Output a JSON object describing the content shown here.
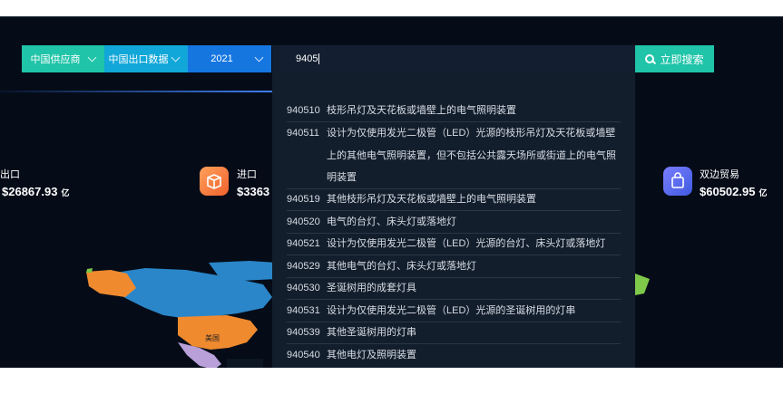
{
  "search": {
    "supplier_select": "中国供应商",
    "data_select": "中国出口数据",
    "year_select": "2021",
    "query": "9405",
    "button_label": "立即搜索"
  },
  "stats": {
    "export": {
      "label": "出口",
      "value": "$26867.93",
      "unit": "亿"
    },
    "import": {
      "label": "进口",
      "value": "$3363"
    },
    "bilateral": {
      "label": "双边贸易",
      "value": "$60502.95",
      "unit": "亿"
    }
  },
  "map": {
    "us_label": "美国"
  },
  "suggestions": [
    {
      "code": "940510",
      "desc": "枝形吊灯及天花板或墙壁上的电气照明装置"
    },
    {
      "code": "940511",
      "desc": "设计为仅使用发光二极管（LED）光源的枝形吊灯及天花板或墙壁上的其他电气照明装置，但不包括公共露天场所或街道上的电气照明装置"
    },
    {
      "code": "940519",
      "desc": "其他枝形吊灯及天花板或墙壁上的电气照明装置"
    },
    {
      "code": "940520",
      "desc": "电气的台灯、床头灯或落地灯"
    },
    {
      "code": "940521",
      "desc": "设计为仅使用发光二极管（LED）光源的台灯、床头灯或落地灯"
    },
    {
      "code": "940529",
      "desc": "其他电气的台灯、床头灯或落地灯"
    },
    {
      "code": "940530",
      "desc": "圣诞树用的成套灯具"
    },
    {
      "code": "940531",
      "desc": "设计为仅使用发光二极管（LED）光源的圣诞树用的灯串"
    },
    {
      "code": "940539",
      "desc": "其他圣诞树用的灯串"
    },
    {
      "code": "940540",
      "desc": "其他电灯及照明装置"
    }
  ],
  "colors": {
    "teal": "#20c4a8",
    "cyan": "#11a7d8",
    "blue": "#1676e0",
    "bg": "#050c18",
    "dropdown_bg": "#131e2c"
  }
}
